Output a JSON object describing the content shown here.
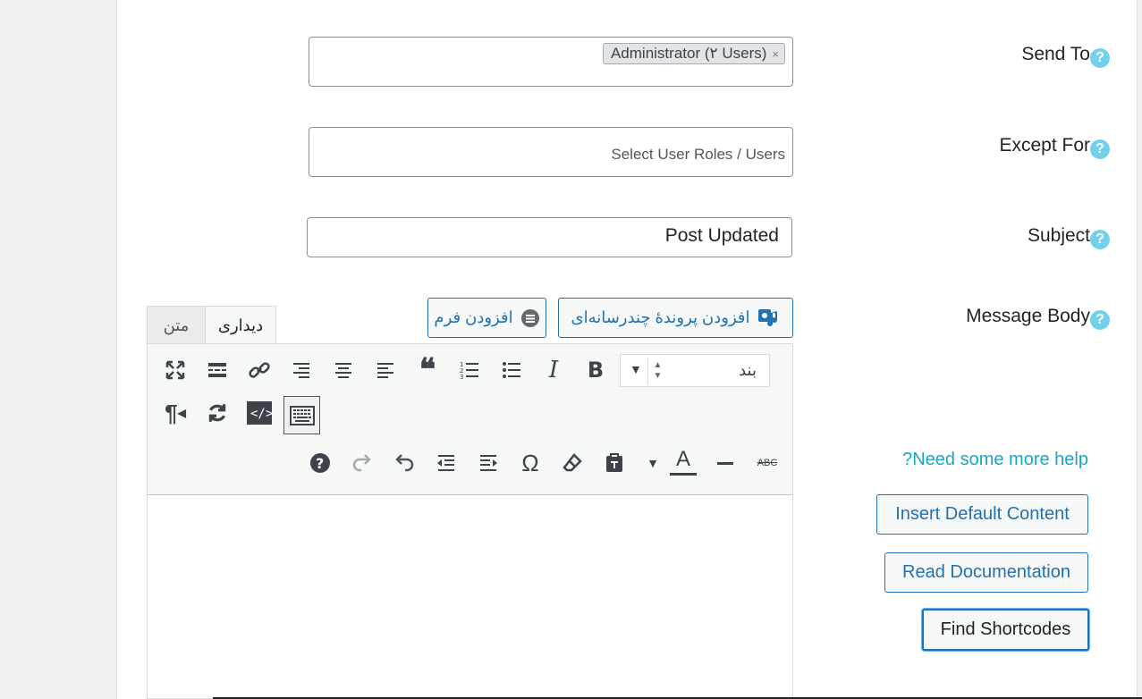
{
  "form": {
    "send_to": {
      "label": "Send To",
      "tag": "Administrator (۲ Users)",
      "tag_remove": "×"
    },
    "except_for": {
      "label": "Except For",
      "placeholder": "Select User Roles / Users"
    },
    "subject": {
      "label": "Subject",
      "value": "Post Updated"
    },
    "message_body": {
      "label": "Message Body"
    },
    "help_glyph": "?"
  },
  "editor": {
    "add_media_label": "افزودن پروندهٔ چندرسانه‌ای",
    "add_form_label": "افزودن فرم",
    "tab_visual": "دیداری",
    "tab_text": "متن",
    "format_value": "بند",
    "toolbar_icons_row1": [
      "fullscreen-icon",
      "read-more-icon",
      "link-icon",
      "align-right-icon",
      "align-center-icon",
      "align-left-icon",
      "blockquote-icon",
      "numbered-list-icon",
      "bulleted-list-icon",
      "italic-icon",
      "bold-icon"
    ],
    "toolbar_icons_row2": [
      "rtl-icon",
      "refresh-icon",
      "code-icon",
      "keyboard-toggle-icon"
    ],
    "toolbar_icons_row3": [
      "help-icon",
      "redo-icon",
      "undo-icon",
      "outdent-icon",
      "indent-icon",
      "special-char-icon",
      "clear-format-icon",
      "paste-text-icon",
      "text-color-dropdown-icon",
      "text-color-icon",
      "horizontal-line-icon",
      "strikethrough-icon"
    ],
    "glyphs": {
      "italic": "I",
      "bold": "B",
      "omega": "Ω",
      "color": "A",
      "abc": "ABC",
      "quote": "❝",
      "pilcrow": "¶",
      "help": "?"
    }
  },
  "sidebar": {
    "help_link": "Need some more help?",
    "insert_default": "Insert Default Content",
    "read_docs": "Read Documentation",
    "find_shortcodes": "Find Shortcodes"
  }
}
